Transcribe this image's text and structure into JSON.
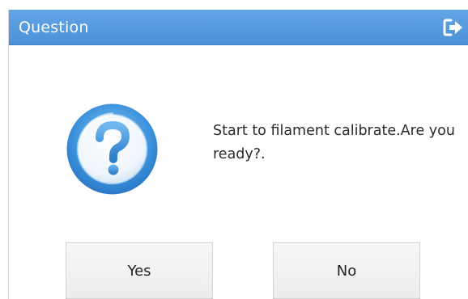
{
  "window": {
    "title": "Question",
    "title_bar_color": "#4b91d8",
    "exit_icon": "exit-icon"
  },
  "dialog": {
    "icon": "question-mark-icon",
    "message": "Start to filament calibrate.Are you ready?."
  },
  "buttons": {
    "yes_label": "Yes",
    "no_label": "No"
  }
}
